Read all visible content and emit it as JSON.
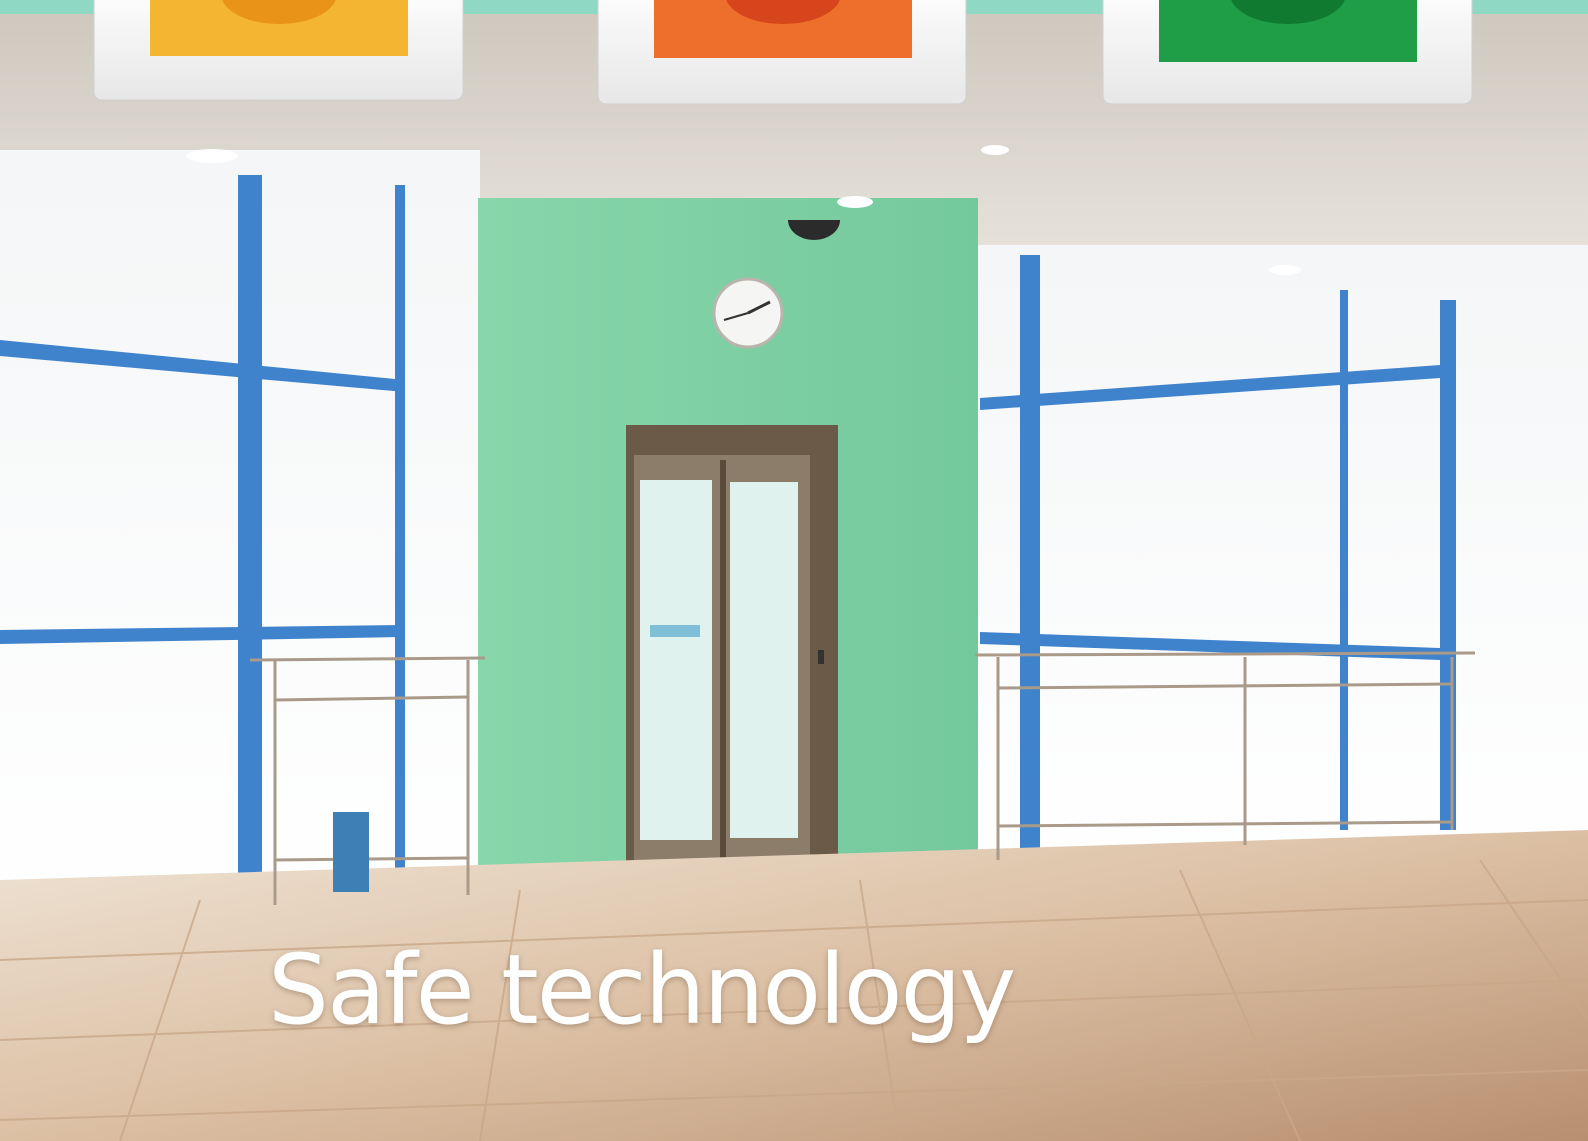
{
  "caption": {
    "text": "Safe technology"
  },
  "switch_tiles": [
    {
      "color": "#f4b531",
      "ring": "#e99418"
    },
    {
      "color": "#ee6e2b",
      "ring": "#d6451c"
    },
    {
      "color": "#1f9e47",
      "ring": "#0f7a30"
    }
  ],
  "colors": {
    "wall_green": "#7fd0a3",
    "frame_blue": "#3f83cc",
    "teal_band": "#8ed8c4",
    "ceiling": "#e6e2da",
    "floor": "#d8b79a",
    "door_frame": "#6b5a48"
  }
}
